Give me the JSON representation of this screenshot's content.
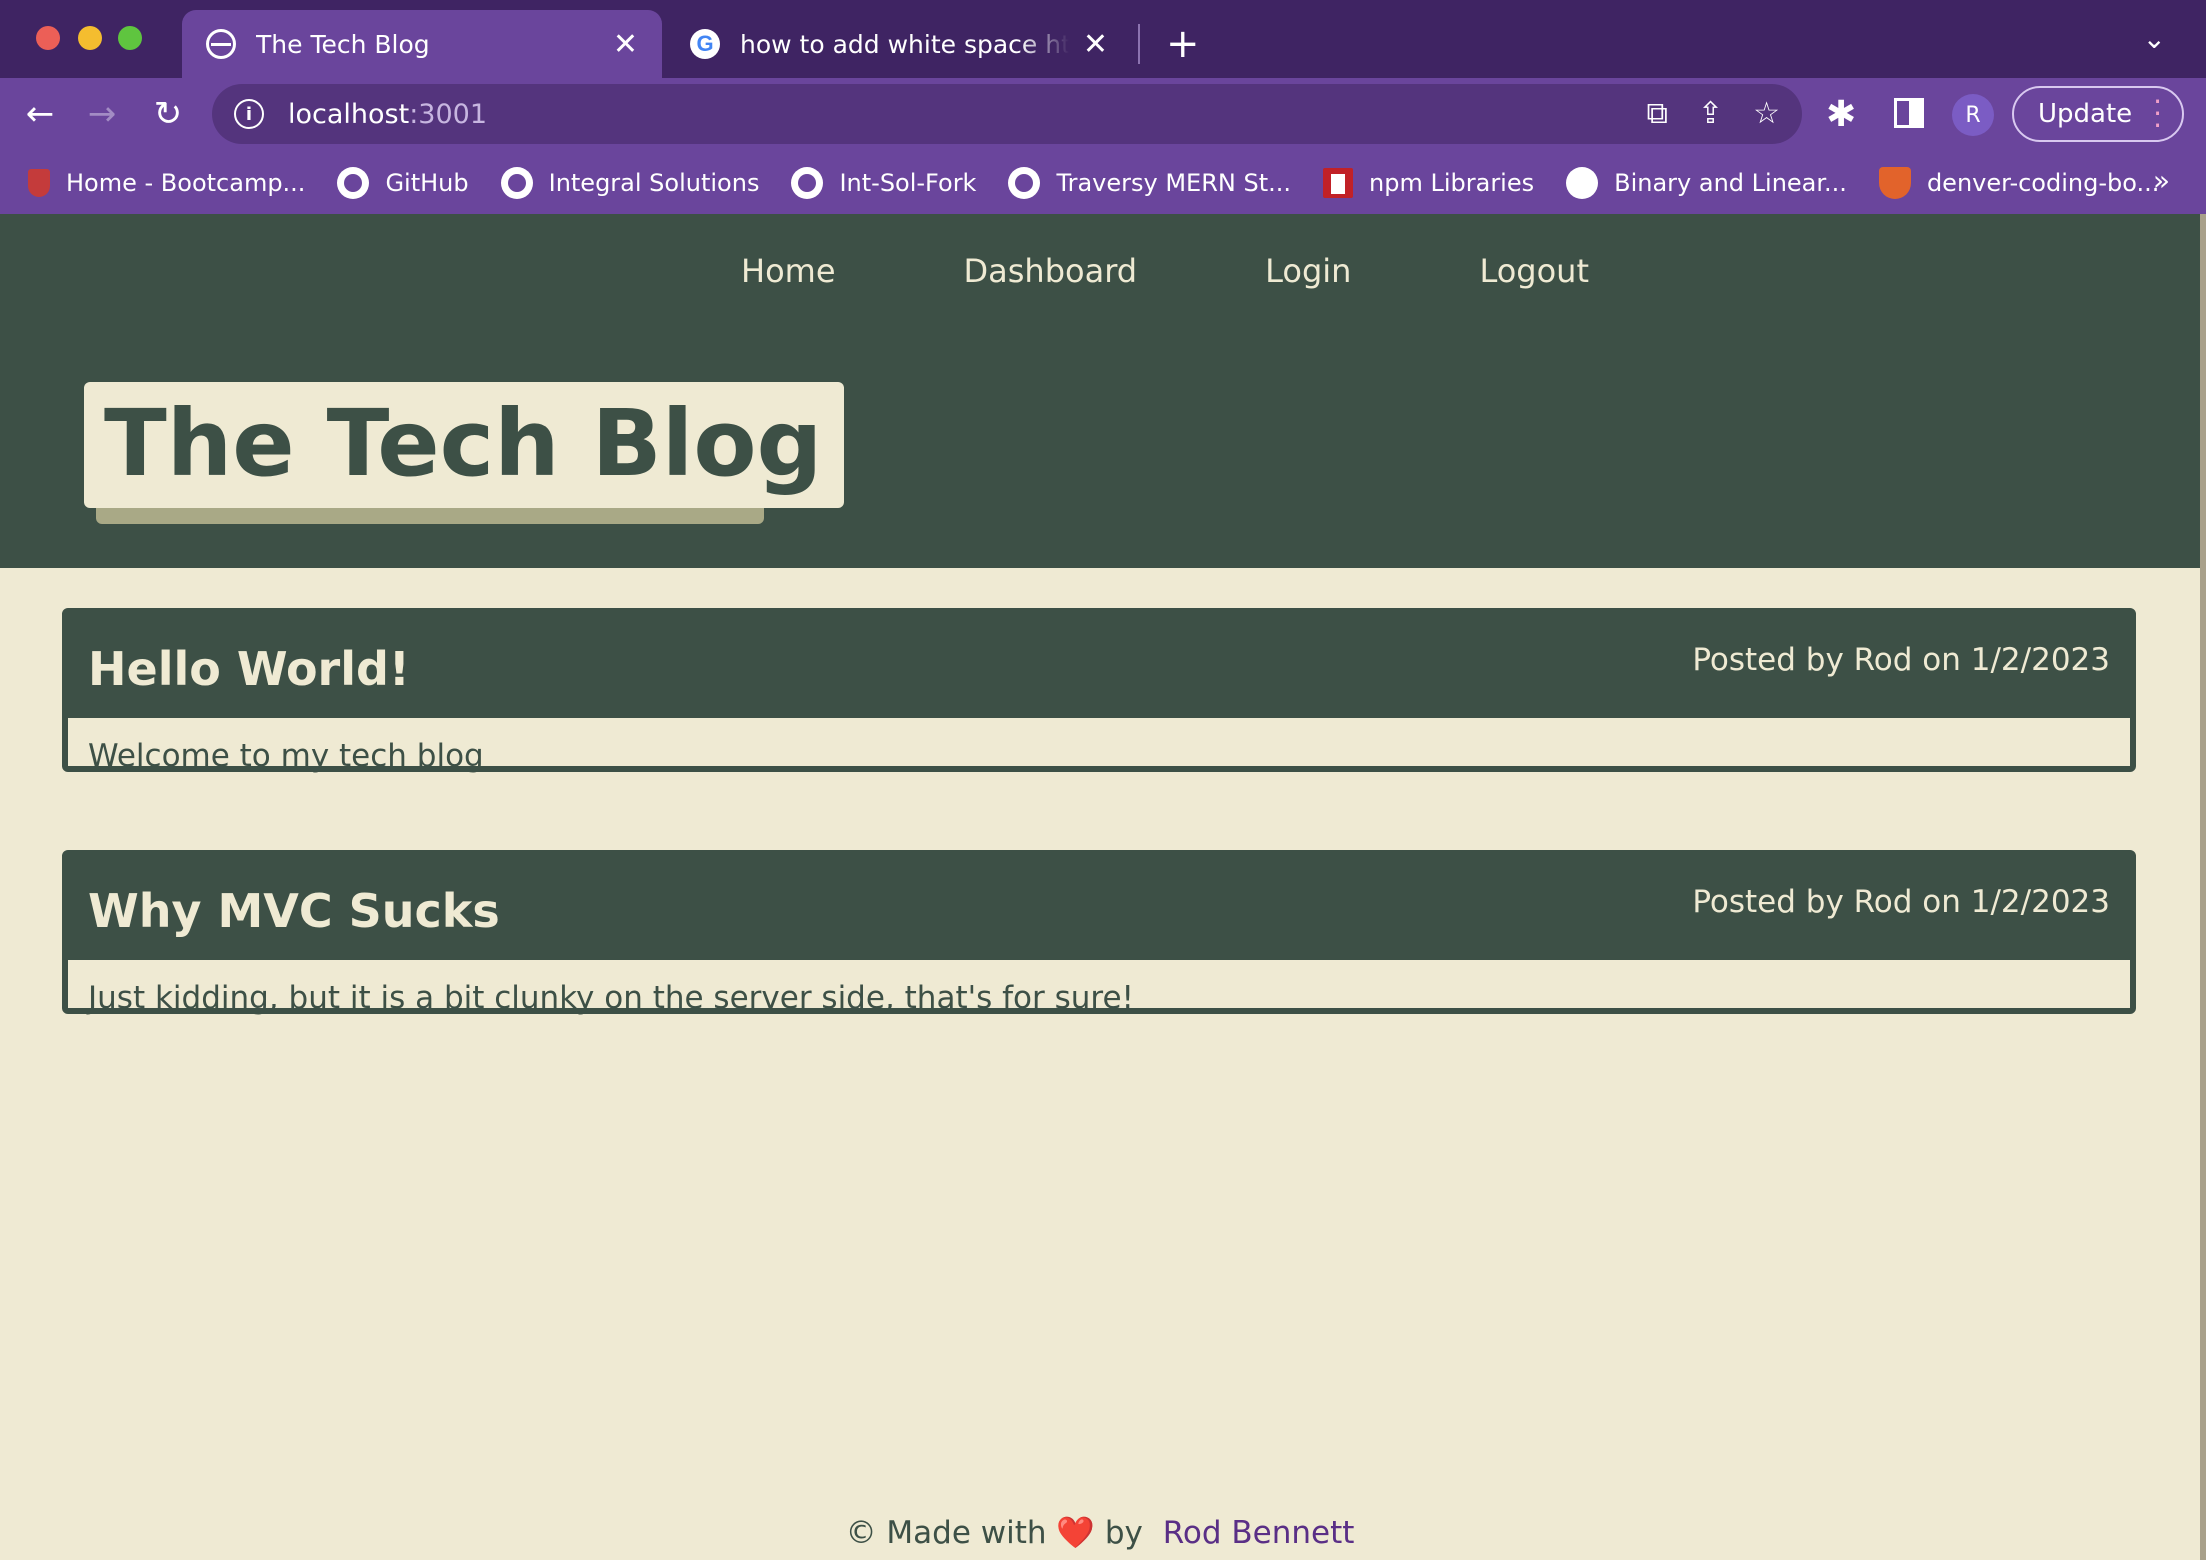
{
  "browser": {
    "tabs": [
      {
        "title": "The Tech Blog",
        "active": true
      },
      {
        "title": "how to add white space html -",
        "active": false
      }
    ],
    "url_host": "localhost",
    "url_port": ":3001",
    "profile_initial": "R",
    "update_label": "Update",
    "bookmarks": [
      {
        "label": "Home - Bootcamp...",
        "icon": "shield-icon"
      },
      {
        "label": "GitHub",
        "icon": "github-icon"
      },
      {
        "label": "Integral Solutions",
        "icon": "github-icon"
      },
      {
        "label": "Int-Sol-Fork",
        "icon": "github-icon"
      },
      {
        "label": "Traversy MERN St...",
        "icon": "github-icon"
      },
      {
        "label": "npm Libraries",
        "icon": "npm-icon"
      },
      {
        "label": "Binary and Linear...",
        "icon": "globe-icon"
      },
      {
        "label": "denver-coding-bo...",
        "icon": "gitlab-icon"
      }
    ],
    "bookmarks_overflow": "»",
    "colors": {
      "frame": "#3f2463",
      "toolbar": "#6a459c"
    }
  },
  "site": {
    "nav": {
      "home": "Home",
      "dashboard": "Dashboard",
      "login": "Login",
      "logout": "Logout"
    },
    "title": "The Tech Blog",
    "posts": [
      {
        "title": "Hello World!",
        "meta": "Posted by Rod on 1/2/2023",
        "body": "Welcome to my tech blog"
      },
      {
        "title": "Why MVC Sucks",
        "meta": "Posted by Rod on 1/2/2023",
        "body": "Just kidding, but it is a bit clunky on the server side, that's for sure!"
      }
    ],
    "footer": {
      "prefix": "© Made with",
      "heart": "❤️",
      "by": "by",
      "author": "Rod Bennett"
    },
    "colors": {
      "primary": "#3d5046",
      "background": "#efead3",
      "accent": "#a9a986",
      "link": "#5a2f86"
    }
  }
}
